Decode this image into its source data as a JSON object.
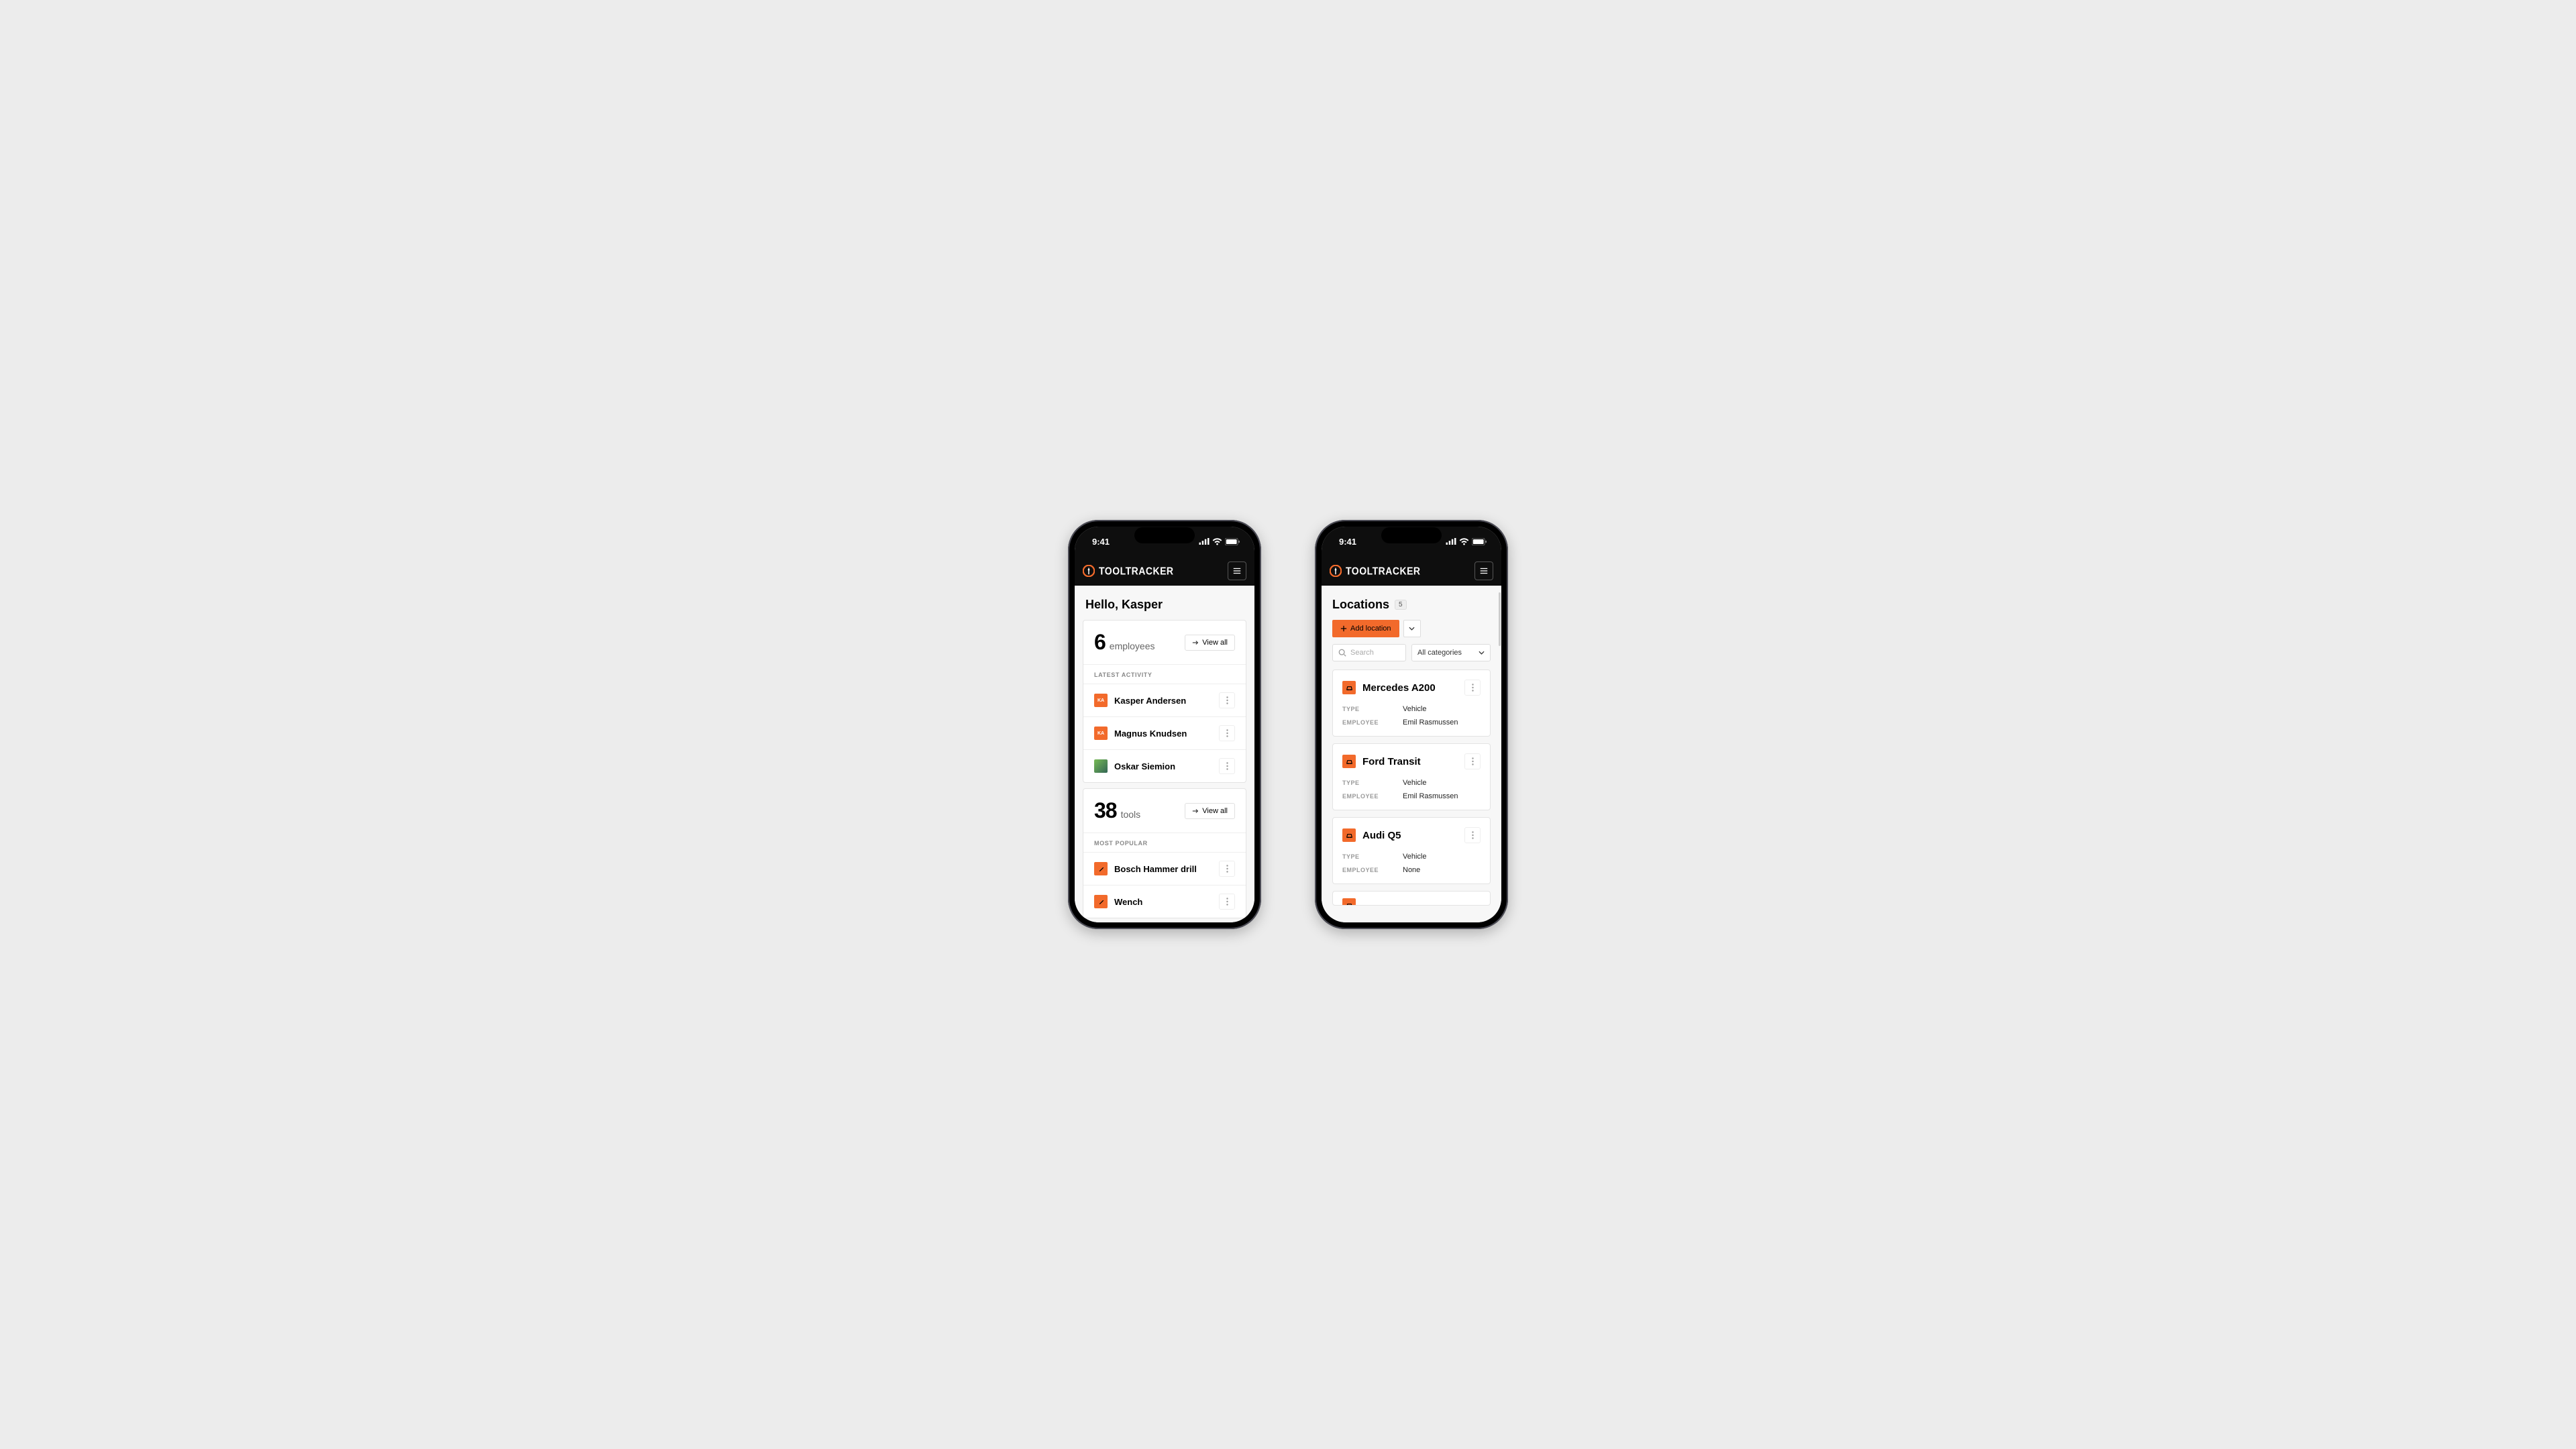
{
  "status": {
    "time": "9:41"
  },
  "brand": {
    "name": "TOOLTRACKER"
  },
  "home": {
    "greeting": "Hello, Kasper",
    "employees": {
      "count": "6",
      "label": "employees",
      "view_all": "View all",
      "section_label": "LATEST ACTIVITY"
    },
    "activity": [
      {
        "initials": "KA",
        "name": "Kasper Andersen"
      },
      {
        "initials": "KA",
        "name": "Magnus Knudsen"
      },
      {
        "initials": "",
        "name": "Oskar Siemion",
        "photo": true
      }
    ],
    "tools": {
      "count": "38",
      "label": "tools",
      "view_all": "View all",
      "section_label": "MOST POPULAR"
    },
    "popular": [
      {
        "name": "Bosch Hammer drill"
      },
      {
        "name": "Wench"
      }
    ]
  },
  "locations": {
    "title": "Locations",
    "count": "5",
    "add_label": "Add location",
    "search_placeholder": "Search",
    "category_label": "All categories",
    "field_type_label": "TYPE",
    "field_employee_label": "EMPLOYEE",
    "items": [
      {
        "name": "Mercedes A200",
        "type": "Vehicle",
        "employee": "Emil Rasmussen"
      },
      {
        "name": "Ford Transit",
        "type": "Vehicle",
        "employee": "Emil Rasmussen"
      },
      {
        "name": "Audi Q5",
        "type": "Vehicle",
        "employee": "None"
      }
    ]
  }
}
